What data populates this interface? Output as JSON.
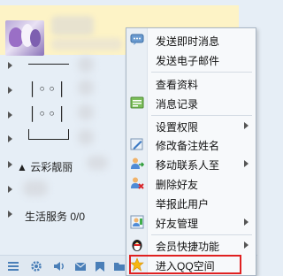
{
  "contact_list": {
    "groups": [
      {
        "label": "▲ 云彩靓丽"
      },
      {
        "label": "生活服务",
        "count": "0/0"
      }
    ]
  },
  "context_menu": {
    "items": [
      {
        "label": "发送即时消息",
        "icon": "chat-bubble-icon"
      },
      {
        "label": "发送电子邮件",
        "icon": ""
      },
      {
        "label": "查看资料",
        "icon": ""
      },
      {
        "label": "消息记录",
        "icon": "message-log-icon"
      },
      {
        "label": "设置权限",
        "icon": "",
        "has_submenu": true
      },
      {
        "label": "修改备注姓名",
        "icon": "edit-name-icon"
      },
      {
        "label": "移动联系人至",
        "icon": "move-contact-icon",
        "has_submenu": true
      },
      {
        "label": "删除好友",
        "icon": "delete-friend-icon"
      },
      {
        "label": "举报此用户",
        "icon": ""
      },
      {
        "label": "好友管理",
        "icon": "friend-manage-icon",
        "has_submenu": true
      },
      {
        "label": "会员快捷功能",
        "icon": "qq-penguin-icon",
        "has_submenu": true
      },
      {
        "label": "进入QQ空间",
        "icon": "qzone-star-icon"
      }
    ]
  },
  "bottom_toolbar": {
    "icons": [
      "menu-icon",
      "settings-gear-icon",
      "volume-icon",
      "mail-icon",
      "favorites-icon",
      "folder-icon"
    ]
  },
  "colors": {
    "selected_row_bg": "#fdf3c6",
    "highlight_border": "#e02020",
    "menu_bg": "#f7f9fb"
  }
}
